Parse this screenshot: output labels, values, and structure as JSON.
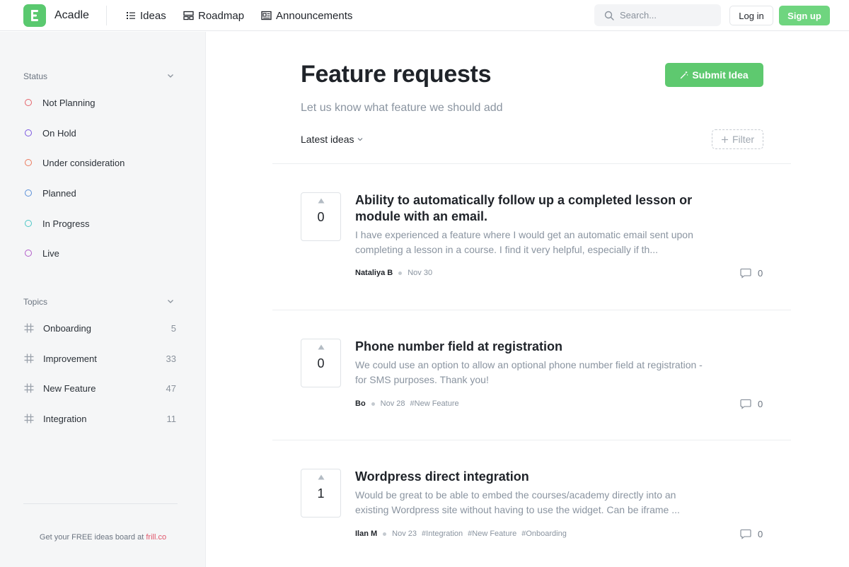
{
  "header": {
    "brand": "Acadle",
    "nav": [
      {
        "label": "Ideas",
        "icon": "list-icon"
      },
      {
        "label": "Roadmap",
        "icon": "roadmap-icon"
      },
      {
        "label": "Announcements",
        "icon": "news-icon"
      }
    ],
    "search_placeholder": "Search...",
    "login_label": "Log in",
    "signup_label": "Sign up"
  },
  "sidebar": {
    "status_heading": "Status",
    "statuses": [
      {
        "label": "Not Planning",
        "color": "#e5636a"
      },
      {
        "label": "On Hold",
        "color": "#7b57e0"
      },
      {
        "label": "Under consideration",
        "color": "#ec7a5e"
      },
      {
        "label": "Planned",
        "color": "#5a8fd8"
      },
      {
        "label": "In Progress",
        "color": "#4cc6c6"
      },
      {
        "label": "Live",
        "color": "#b25bc9"
      }
    ],
    "topics_heading": "Topics",
    "topics": [
      {
        "label": "Onboarding",
        "count": "5"
      },
      {
        "label": "Improvement",
        "count": "33"
      },
      {
        "label": "New Feature",
        "count": "47"
      },
      {
        "label": "Integration",
        "count": "11"
      }
    ],
    "footer_text": "Get your FREE ideas board at ",
    "footer_link": "frill.co"
  },
  "main": {
    "title": "Feature requests",
    "subtitle": "Let us know what feature we should add",
    "submit_label": "Submit Idea",
    "sort_label": "Latest ideas",
    "filter_label": "Filter",
    "ideas": [
      {
        "votes": "0",
        "title": "Ability to automatically follow up a completed lesson or module with an email.",
        "description": "I have experienced a feature where I would get an automatic email sent upon completing a lesson in a course. I find it very helpful, especially if th...",
        "author": "Nataliya B",
        "date": "Nov 30",
        "tags": [],
        "comments": "0"
      },
      {
        "votes": "0",
        "title": "Phone number field at registration",
        "description": "We could use an option to allow an optional phone number field at registration - for SMS purposes. Thank you!",
        "author": "Bo",
        "date": "Nov 28",
        "tags": [
          "#New Feature"
        ],
        "comments": "0"
      },
      {
        "votes": "1",
        "title": "Wordpress direct integration",
        "description": "Would be great to be able to embed the courses/academy directly into an existing Wordpress site without having to use the widget. Can be iframe ...",
        "author": "Ilan M",
        "date": "Nov 23",
        "tags": [
          "#Integration",
          "#New Feature",
          "#Onboarding"
        ],
        "comments": "0"
      }
    ]
  },
  "colors": {
    "accent": "#5ec96f",
    "footer_link": "#e0566b"
  }
}
